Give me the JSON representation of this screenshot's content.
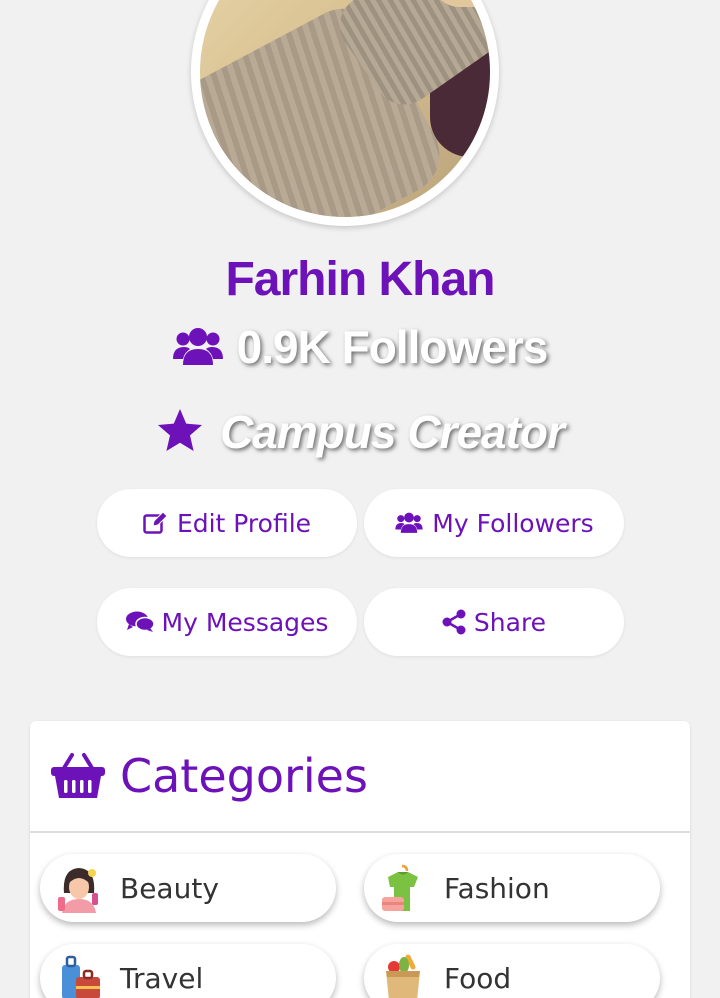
{
  "profile": {
    "name": "Farhin Khan",
    "followers": "0.9K Followers",
    "role": "Campus Creator"
  },
  "actions": {
    "edit_profile": "Edit Profile",
    "my_followers": "My Followers",
    "my_messages": "My Messages",
    "share": "Share"
  },
  "categories": {
    "title": "Categories",
    "items": [
      {
        "label": "Beauty",
        "icon": "beauty-icon"
      },
      {
        "label": "Fashion",
        "icon": "fashion-icon"
      },
      {
        "label": "Travel",
        "icon": "travel-icon"
      },
      {
        "label": "Food",
        "icon": "food-icon"
      }
    ]
  },
  "colors": {
    "accent": "#6d12b9",
    "background": "#f1f1f1"
  }
}
